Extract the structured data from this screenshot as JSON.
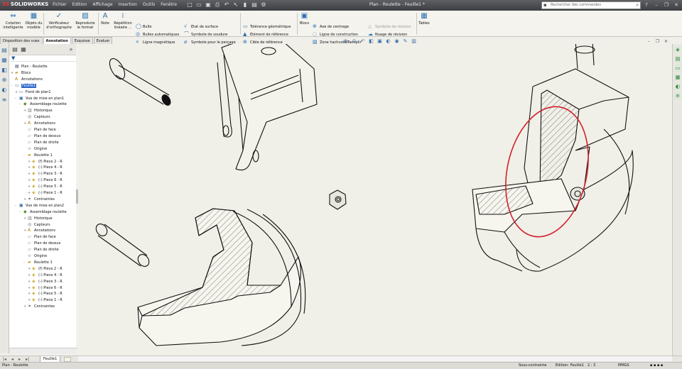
{
  "app": {
    "brand": "SOLIDWORKS",
    "brand_mark": "3S",
    "doc_title": "Plan - Roulette - Feuille1 *"
  },
  "menu": [
    "Fichier",
    "Edition",
    "Affichage",
    "Insertion",
    "Outils",
    "Fenêtre"
  ],
  "search": {
    "placeholder": "Rechercher des commandes"
  },
  "ribbon": {
    "cotation": "Cotation intelligente",
    "objets": "Objets du modèle",
    "verificateur": "Vérificateur d'orthographe",
    "reproduire": "Reproduire le format",
    "note": "Note",
    "repetition": "Répétition linéaire ...",
    "bulle": "Bulle",
    "bulles_auto": "Bulles automatiques",
    "bulle_magnetique": "Ligne magnétique",
    "etat_surface": "Etat de surface",
    "symbole_soudure": "Symbole de soudure",
    "symbole_percage": "Symbole pour le perçage",
    "tolerance": "Tolérance géométrique",
    "element_ref": "Elément de référence",
    "cible_ref": "Cible de référence",
    "blocs": "Blocs",
    "axe_centrage": "Axe de centrage",
    "ligne_construction": "Ligne de construction",
    "zone_hachuree": "Zone hachurée/Remplir",
    "symbole_revision": "Symbole de révision",
    "nuage_revision": "Nuage de révision",
    "tables": "Tables"
  },
  "tabs": [
    "Disposition des vues",
    "Annotation",
    "Esquisse",
    "Evaluer"
  ],
  "active_tab": "Annotation",
  "tree": [
    {
      "label": "Plan - Roulette",
      "level": 0,
      "icon": "drawing",
      "toggle": ""
    },
    {
      "label": "Blocs",
      "level": 0,
      "icon": "folder",
      "toggle": "+"
    },
    {
      "label": "Annotations",
      "level": 0,
      "icon": "annotation",
      "toggle": ""
    },
    {
      "label": "Feuille1",
      "level": 0,
      "icon": "sheet",
      "toggle": "-",
      "selected": true
    },
    {
      "label": "Fond de plan1",
      "level": 1,
      "icon": "sheet",
      "toggle": "+"
    },
    {
      "label": "Vue de mise en plan1",
      "level": 1,
      "icon": "view",
      "toggle": "-"
    },
    {
      "label": "Assemblage roulette",
      "level": 2,
      "icon": "assembly",
      "toggle": "-"
    },
    {
      "label": "Historique",
      "level": 3,
      "icon": "history",
      "toggle": "+"
    },
    {
      "label": "Capteurs",
      "level": 3,
      "icon": "sensor",
      "toggle": ""
    },
    {
      "label": "Annotations",
      "level": 3,
      "icon": "annotation",
      "toggle": "+"
    },
    {
      "label": "Plan de face",
      "level": 3,
      "icon": "plane",
      "toggle": ""
    },
    {
      "label": "Plan de dessus",
      "level": 3,
      "icon": "plane",
      "toggle": ""
    },
    {
      "label": "Plan de droite",
      "level": 3,
      "icon": "plane",
      "toggle": ""
    },
    {
      "label": "Origine",
      "level": 3,
      "icon": "origin",
      "toggle": ""
    },
    {
      "label": "Roulette 1",
      "level": 3,
      "icon": "folder",
      "toggle": "-"
    },
    {
      "label": "(f) Piece 2 - R",
      "level": 4,
      "icon": "part",
      "toggle": "+"
    },
    {
      "label": "(-) Piece 4 - R",
      "level": 4,
      "icon": "part",
      "toggle": "+"
    },
    {
      "label": "(-) Piece 3 - R",
      "level": 4,
      "icon": "part",
      "toggle": "+"
    },
    {
      "label": "(-) Piece 6 - R",
      "level": 4,
      "icon": "part",
      "toggle": "+"
    },
    {
      "label": "(-) Piece 5 - R",
      "level": 4,
      "icon": "part",
      "toggle": "+"
    },
    {
      "label": "(-) Piece 1 - R",
      "level": 4,
      "icon": "part",
      "toggle": "+"
    },
    {
      "label": "Contraintes",
      "level": 3,
      "icon": "mates",
      "toggle": "+"
    },
    {
      "label": "Vue de mise en plan2",
      "level": 1,
      "icon": "view",
      "toggle": "-"
    },
    {
      "label": "Assemblage roulette",
      "level": 2,
      "icon": "assembly",
      "toggle": "-"
    },
    {
      "label": "Historique",
      "level": 3,
      "icon": "history",
      "toggle": "+"
    },
    {
      "label": "Capteurs",
      "level": 3,
      "icon": "sensor",
      "toggle": ""
    },
    {
      "label": "Annotations",
      "level": 3,
      "icon": "annotation",
      "toggle": "+"
    },
    {
      "label": "Plan de face",
      "level": 3,
      "icon": "plane",
      "toggle": ""
    },
    {
      "label": "Plan de dessus",
      "level": 3,
      "icon": "plane",
      "toggle": ""
    },
    {
      "label": "Plan de droite",
      "level": 3,
      "icon": "plane",
      "toggle": ""
    },
    {
      "label": "Origine",
      "level": 3,
      "icon": "origin",
      "toggle": ""
    },
    {
      "label": "Roulette 1",
      "level": 3,
      "icon": "folder",
      "toggle": "-"
    },
    {
      "label": "(f) Piece 2 - R",
      "level": 4,
      "icon": "part",
      "toggle": "+"
    },
    {
      "label": "(-) Piece 4 - R",
      "level": 4,
      "icon": "part",
      "toggle": "+"
    },
    {
      "label": "(-) Piece 3 - R",
      "level": 4,
      "icon": "part",
      "toggle": "+"
    },
    {
      "label": "(-) Piece 6 - R",
      "level": 4,
      "icon": "part",
      "toggle": "+"
    },
    {
      "label": "(-) Piece 5 - R",
      "level": 4,
      "icon": "part",
      "toggle": "+"
    },
    {
      "label": "(-) Piece 1 - R",
      "level": 4,
      "icon": "part",
      "toggle": "+"
    },
    {
      "label": "Contraintes",
      "level": 3,
      "icon": "mates",
      "toggle": "+"
    }
  ],
  "sheet_tab": "Feuille1",
  "status": {
    "doc": "Plan - Roulette",
    "state": "Sous-contrainte",
    "editing": "Edition: Feuille1",
    "scale": "2 : 3",
    "units": "MMGS"
  },
  "colors": {
    "highlight": "#d0202a",
    "selection": "#2f68c9",
    "drawing_bg": "#f1f0e8"
  }
}
